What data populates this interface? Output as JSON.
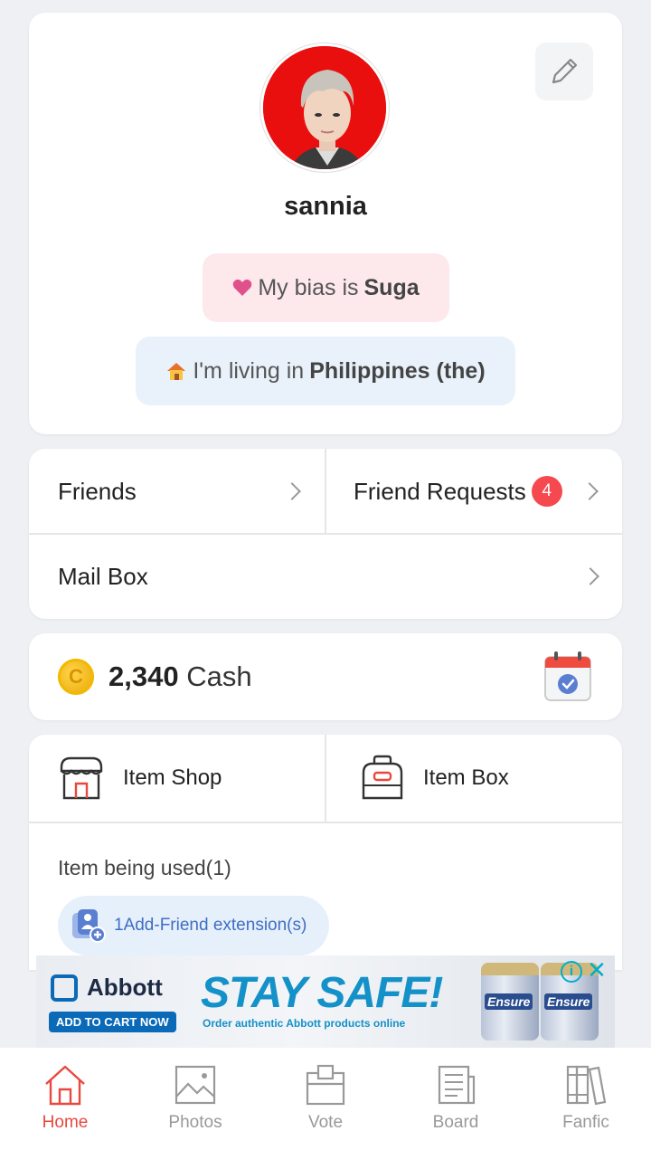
{
  "profile": {
    "username": "sannia",
    "bias_prefix": "My bias is",
    "bias_name": "Suga",
    "living_prefix": "I'm living in",
    "living_place": "Philippines (the)",
    "avatar_bg": "#ea0f0f"
  },
  "social": {
    "friends_label": "Friends",
    "friend_requests_label": "Friend Requests",
    "friend_requests_count": "4",
    "mailbox_label": "Mail Box"
  },
  "cash": {
    "amount": "2,340",
    "unit": "Cash"
  },
  "items": {
    "shop_label": "Item Shop",
    "box_label": "Item Box",
    "used_label": "Item being used(1)",
    "extension_label": "1Add-Friend extension(s)"
  },
  "ad": {
    "brand": "Abbott",
    "cta": "ADD TO CART NOW",
    "headline": "STAY SAFE!",
    "subline": "Order authentic Abbott products online",
    "product_1": "Ensure",
    "product_2": "Ensure"
  },
  "nav": {
    "items": [
      {
        "label": "Home",
        "icon": "home-icon",
        "active": true
      },
      {
        "label": "Photos",
        "icon": "photo-icon",
        "active": false
      },
      {
        "label": "Vote",
        "icon": "vote-box-icon",
        "active": false
      },
      {
        "label": "Board",
        "icon": "board-icon",
        "active": false
      },
      {
        "label": "Fanfic",
        "icon": "books-icon",
        "active": false
      }
    ]
  },
  "colors": {
    "accent": "#e8493f",
    "badge": "#f5484f",
    "bias_pill": "#fde8ec",
    "living_pill": "#e9f2fb"
  }
}
